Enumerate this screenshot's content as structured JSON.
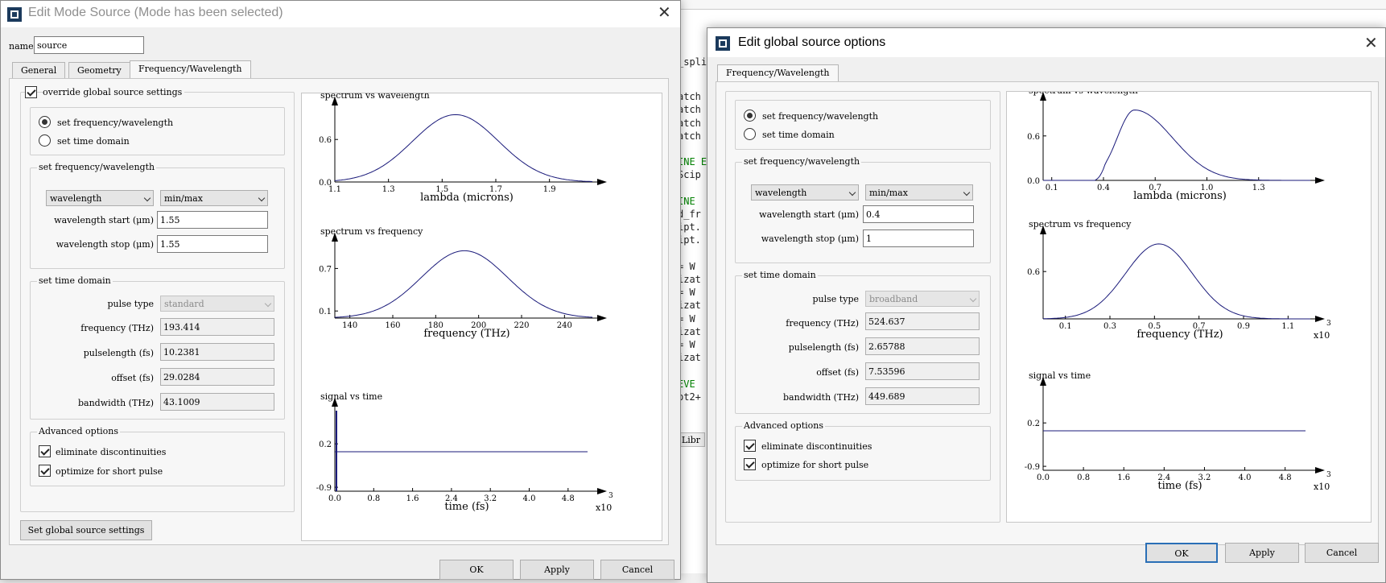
{
  "background": {
    "split_label": "_spli",
    "code_lines": [
      "",
      "atch",
      "atch",
      "atch",
      "atch",
      "",
      "INE E",
      "Scip",
      "",
      "INE",
      "d_fr",
      "ipt.",
      "ipt.",
      "",
      "= W",
      "izat",
      "= W",
      "izat",
      "= W",
      "izat",
      "= W",
      "izat",
      "",
      "EVE",
      "pt2+"
    ],
    "lib_label": "t Libr"
  },
  "left_dialog": {
    "title": "Edit Mode Source (Mode has been selected)",
    "name_label": "name",
    "name_value": "source",
    "tabs": [
      "General",
      "Geometry",
      "Frequency/Wavelength"
    ],
    "override_label": "override global source settings",
    "radio_freq": "set frequency/wavelength",
    "radio_time": "set time domain",
    "group_freq": "set frequency/wavelength",
    "select_type": "wavelength",
    "select_range": "min/max",
    "wl_start_label": "wavelength start (μm)",
    "wl_start_value": "1.55",
    "wl_stop_label": "wavelength stop (μm)",
    "wl_stop_value": "1.55",
    "group_time": "set time domain",
    "pulse_type_label": "pulse type",
    "pulse_type_value": "standard",
    "frequency_label": "frequency (THz)",
    "frequency_value": "193.414",
    "pulselength_label": "pulselength (fs)",
    "pulselength_value": "10.2381",
    "offset_label": "offset (fs)",
    "offset_value": "29.0284",
    "bandwidth_label": "bandwidth (THz)",
    "bandwidth_value": "43.1009",
    "group_adv": "Advanced options",
    "elim_label": "eliminate discontinuities",
    "opt_label": "optimize for short pulse",
    "global_button": "Set global source settings",
    "ok": "OK",
    "apply": "Apply",
    "cancel": "Cancel"
  },
  "right_dialog": {
    "title": "Edit global source options",
    "tab": "Frequency/Wavelength",
    "radio_freq": "set frequency/wavelength",
    "radio_time": "set time domain",
    "group_freq": "set frequency/wavelength",
    "select_type": "wavelength",
    "select_range": "min/max",
    "wl_start_label": "wavelength start (μm)",
    "wl_start_value": "0.4",
    "wl_stop_label": "wavelength stop (μm)",
    "wl_stop_value": "1",
    "group_time": "set time domain",
    "pulse_type_label": "pulse type",
    "pulse_type_value": "broadband",
    "frequency_label": "frequency (THz)",
    "frequency_value": "524.637",
    "pulselength_label": "pulselength (fs)",
    "pulselength_value": "2.65788",
    "offset_label": "offset (fs)",
    "offset_value": "7.53596",
    "bandwidth_label": "bandwidth (THz)",
    "bandwidth_value": "449.689",
    "group_adv": "Advanced options",
    "elim_label": "eliminate discontinuities",
    "opt_label": "optimize for short pulse",
    "ok": "OK",
    "apply": "Apply",
    "cancel": "Cancel"
  },
  "chart_data": [
    {
      "type": "line",
      "title": "spectrum vs wavelength",
      "xlabel": "lambda (microns)",
      "x_ticks": [
        "1.1",
        "1.3",
        "1.5",
        "1.7",
        "1.9"
      ],
      "y_ticks": [
        "0.0",
        "0.6"
      ],
      "x_range": [
        1.1,
        2.06
      ],
      "y_range": [
        0,
        1.0
      ],
      "curve": {
        "kind": "gauss",
        "center": 1.55,
        "sigma": 0.16,
        "peak": 0.95
      }
    },
    {
      "type": "line",
      "title": "spectrum vs frequency",
      "xlabel": "frequency (THz)",
      "x_ticks": [
        "140",
        "160",
        "180",
        "200",
        "220",
        "240"
      ],
      "y_ticks": [
        "0.1",
        "0.7"
      ],
      "x_range": [
        133,
        253
      ],
      "y_range": [
        0,
        1.0
      ],
      "curve": {
        "kind": "gauss",
        "center": 193.4,
        "sigma": 20,
        "peak": 0.95
      }
    },
    {
      "type": "line",
      "title": "signal vs time",
      "xlabel": "time (fs)",
      "x_exponent": "x10",
      "exponent_power": "3",
      "x_ticks": [
        "0.0",
        "0.8",
        "1.6",
        "2.4",
        "3.2",
        "4.0",
        "4.8"
      ],
      "y_ticks": [
        "0.2",
        "-0.9"
      ],
      "x_range": [
        0,
        5.3
      ],
      "y_range": [
        -1.0,
        1.0
      ],
      "curve": {
        "kind": "flat",
        "level": 0.0,
        "spike_at": 0.02
      }
    },
    {
      "type": "line",
      "title": "spectrum vs wavelength",
      "xlabel": "lambda (microns)",
      "x_ticks": [
        "0.1",
        "0.4",
        "0.7",
        "1.0",
        "1.3"
      ],
      "y_ticks": [
        "0.0",
        "0.6"
      ],
      "x_range": [
        0.05,
        1.6
      ],
      "y_range": [
        0,
        1.0
      ],
      "curve": {
        "kind": "skew",
        "onset": 0.35,
        "center": 0.58,
        "rise": 0.1,
        "decay": 0.22,
        "peak": 0.95
      }
    },
    {
      "type": "line",
      "title": "spectrum vs frequency",
      "xlabel": "frequency (THz)",
      "x_exponent": "x10",
      "exponent_power": "3",
      "x_ticks": [
        "0.1",
        "0.3",
        "0.5",
        "0.7",
        "0.9",
        "1.1"
      ],
      "y_ticks": [
        "0.6"
      ],
      "x_range": [
        0.0,
        1.2
      ],
      "y_range": [
        0,
        1.0
      ],
      "curve": {
        "kind": "gauss",
        "center": 0.52,
        "sigma": 0.15,
        "peak": 0.95
      }
    },
    {
      "type": "line",
      "title": "signal vs time",
      "xlabel": "time (fs)",
      "x_exponent": "x10",
      "exponent_power": "3",
      "x_ticks": [
        "0.0",
        "0.8",
        "1.6",
        "2.4",
        "3.2",
        "4.0",
        "4.8"
      ],
      "y_ticks": [
        "0.2",
        "-0.9"
      ],
      "x_range": [
        0,
        5.3
      ],
      "y_range": [
        -1.0,
        1.0
      ],
      "curve": {
        "kind": "flat",
        "level": 0.0,
        "spike_at": null
      }
    }
  ]
}
